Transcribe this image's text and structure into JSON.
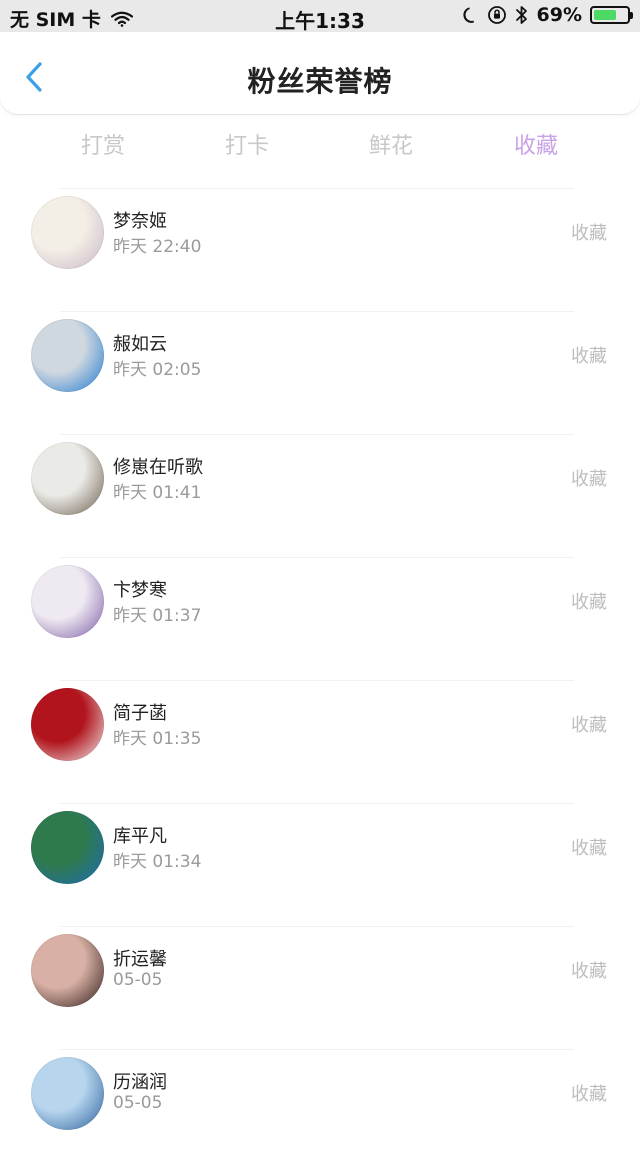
{
  "status_bar": {
    "carrier": "无 SIM 卡",
    "time": "上午1:33",
    "battery": "69%",
    "battery_level": 0.69,
    "colors": {
      "battery_fill": "#4cd964"
    }
  },
  "nav": {
    "title": "粉丝荣誉榜",
    "back_icon": "chevron-left-icon",
    "accent": "#3aa0ea"
  },
  "tabs": [
    {
      "label": "打赏"
    },
    {
      "label": "打卡"
    },
    {
      "label": "鲜花"
    },
    {
      "label": "收藏",
      "active": true
    }
  ],
  "active_color": "#c9a2e6",
  "list": [
    {
      "name": "梦奈姬",
      "time": "昨天 22:40",
      "action": "收藏",
      "avatar_colors": [
        "#f4efe6",
        "#c8b6c6"
      ]
    },
    {
      "name": "赧如云",
      "time": "昨天 02:05",
      "action": "收藏",
      "avatar_colors": [
        "#cfd7df",
        "#1b78d1"
      ]
    },
    {
      "name": "修崽在听歌",
      "time": "昨天 01:41",
      "action": "收藏",
      "avatar_colors": [
        "#eaeae6",
        "#6b5a4a"
      ]
    },
    {
      "name": "卞梦寒",
      "time": "昨天 01:37",
      "action": "收藏",
      "avatar_colors": [
        "#efeaf2",
        "#7a5aa3"
      ]
    },
    {
      "name": "简子菡",
      "time": "昨天 01:35",
      "action": "收藏",
      "avatar_colors": [
        "#b1141c",
        "#f1f1f1"
      ]
    },
    {
      "name": "库平凡",
      "time": "昨天 01:34",
      "action": "收藏",
      "avatar_colors": [
        "#2f7a4d",
        "#1e6bb6"
      ]
    },
    {
      "name": "折运馨",
      "time": "05-05",
      "action": "收藏",
      "avatar_colors": [
        "#d9b0a5",
        "#2a1a16"
      ]
    },
    {
      "name": "历涵润",
      "time": "05-05",
      "action": "收藏",
      "avatar_colors": [
        "#b7d6ee",
        "#2a5f9a"
      ]
    }
  ]
}
